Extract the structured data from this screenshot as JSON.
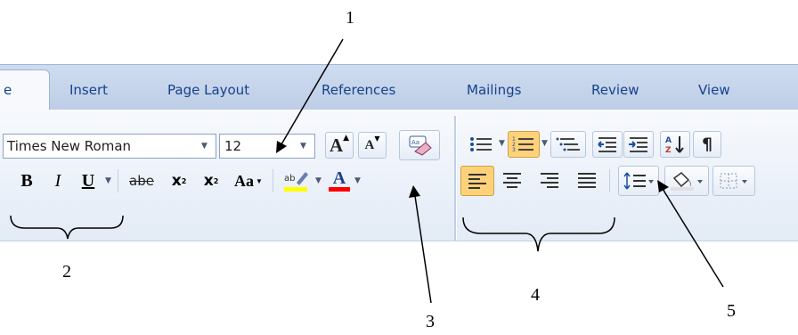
{
  "tabs": {
    "home_partial": "e",
    "insert": "Insert",
    "page_layout": "Page Layout",
    "references": "References",
    "mailings": "Mailings",
    "review": "Review",
    "view": "View"
  },
  "font": {
    "name": "Times New Roman",
    "size": "12",
    "grow": "A",
    "shrink": "A"
  },
  "format": {
    "bold": "B",
    "italic": "I",
    "underline": "U",
    "strike": "abe",
    "sub": "x",
    "sup": "x",
    "case": "Aa",
    "highlight": "ab",
    "fontcolor": "A"
  },
  "para": {
    "pilcrow": "¶"
  },
  "annotations": {
    "n1": "1",
    "n2": "2",
    "n3": "3",
    "n4": "4",
    "n5": "5"
  },
  "colors": {
    "highlight": "#ffff00",
    "fontcolor": "#ff0000",
    "active": "#ffd27a",
    "text": "#15428b"
  }
}
